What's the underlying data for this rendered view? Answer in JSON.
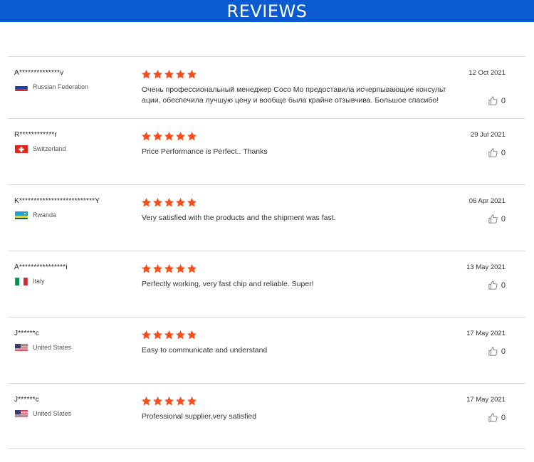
{
  "header": {
    "title": "REVIEWS"
  },
  "colors": {
    "banner": "#0a5bd1",
    "star": "#f0501e",
    "divider": "#d9d9d9"
  },
  "reviews": [
    {
      "name": "A**************v",
      "country": "Russian Federation",
      "flag": "russia",
      "rating": 5,
      "text": "Очень профессиональный менеджер Coco Mo предоставила исчерпывающие консульт ации, обеспечила лучшую цену и вообще была крайне отзывчива. Большое спасибо!",
      "date": "12 Oct 2021",
      "likes": "0"
    },
    {
      "name": "R************r",
      "country": "Switzerland",
      "flag": "switzerland",
      "rating": 5,
      "text": "Price Performance is Perfect.. Thanks",
      "date": "29 Jul 2021",
      "likes": "0"
    },
    {
      "name": "K**************************Y",
      "country": "Rwanda",
      "flag": "rwanda",
      "rating": 5,
      "text": "Very satisfied with the products and the shipment was fast.",
      "date": "06 Apr 2021",
      "likes": "0"
    },
    {
      "name": "A****************i",
      "country": "Italy",
      "flag": "italy",
      "rating": 5,
      "text": "Perfectly working, very fast chip and reliable. Super!",
      "date": "13 May 2021",
      "likes": "0"
    },
    {
      "name": "J******c",
      "country": "United States",
      "flag": "usa",
      "rating": 5,
      "text": "Easy to communicate and understand",
      "date": "17 May 2021",
      "likes": "0"
    },
    {
      "name": "J******c",
      "country": "United States",
      "flag": "usa",
      "rating": 5,
      "text": "Professional supplier,very satisfied",
      "date": "17 May 2021",
      "likes": "0"
    }
  ]
}
